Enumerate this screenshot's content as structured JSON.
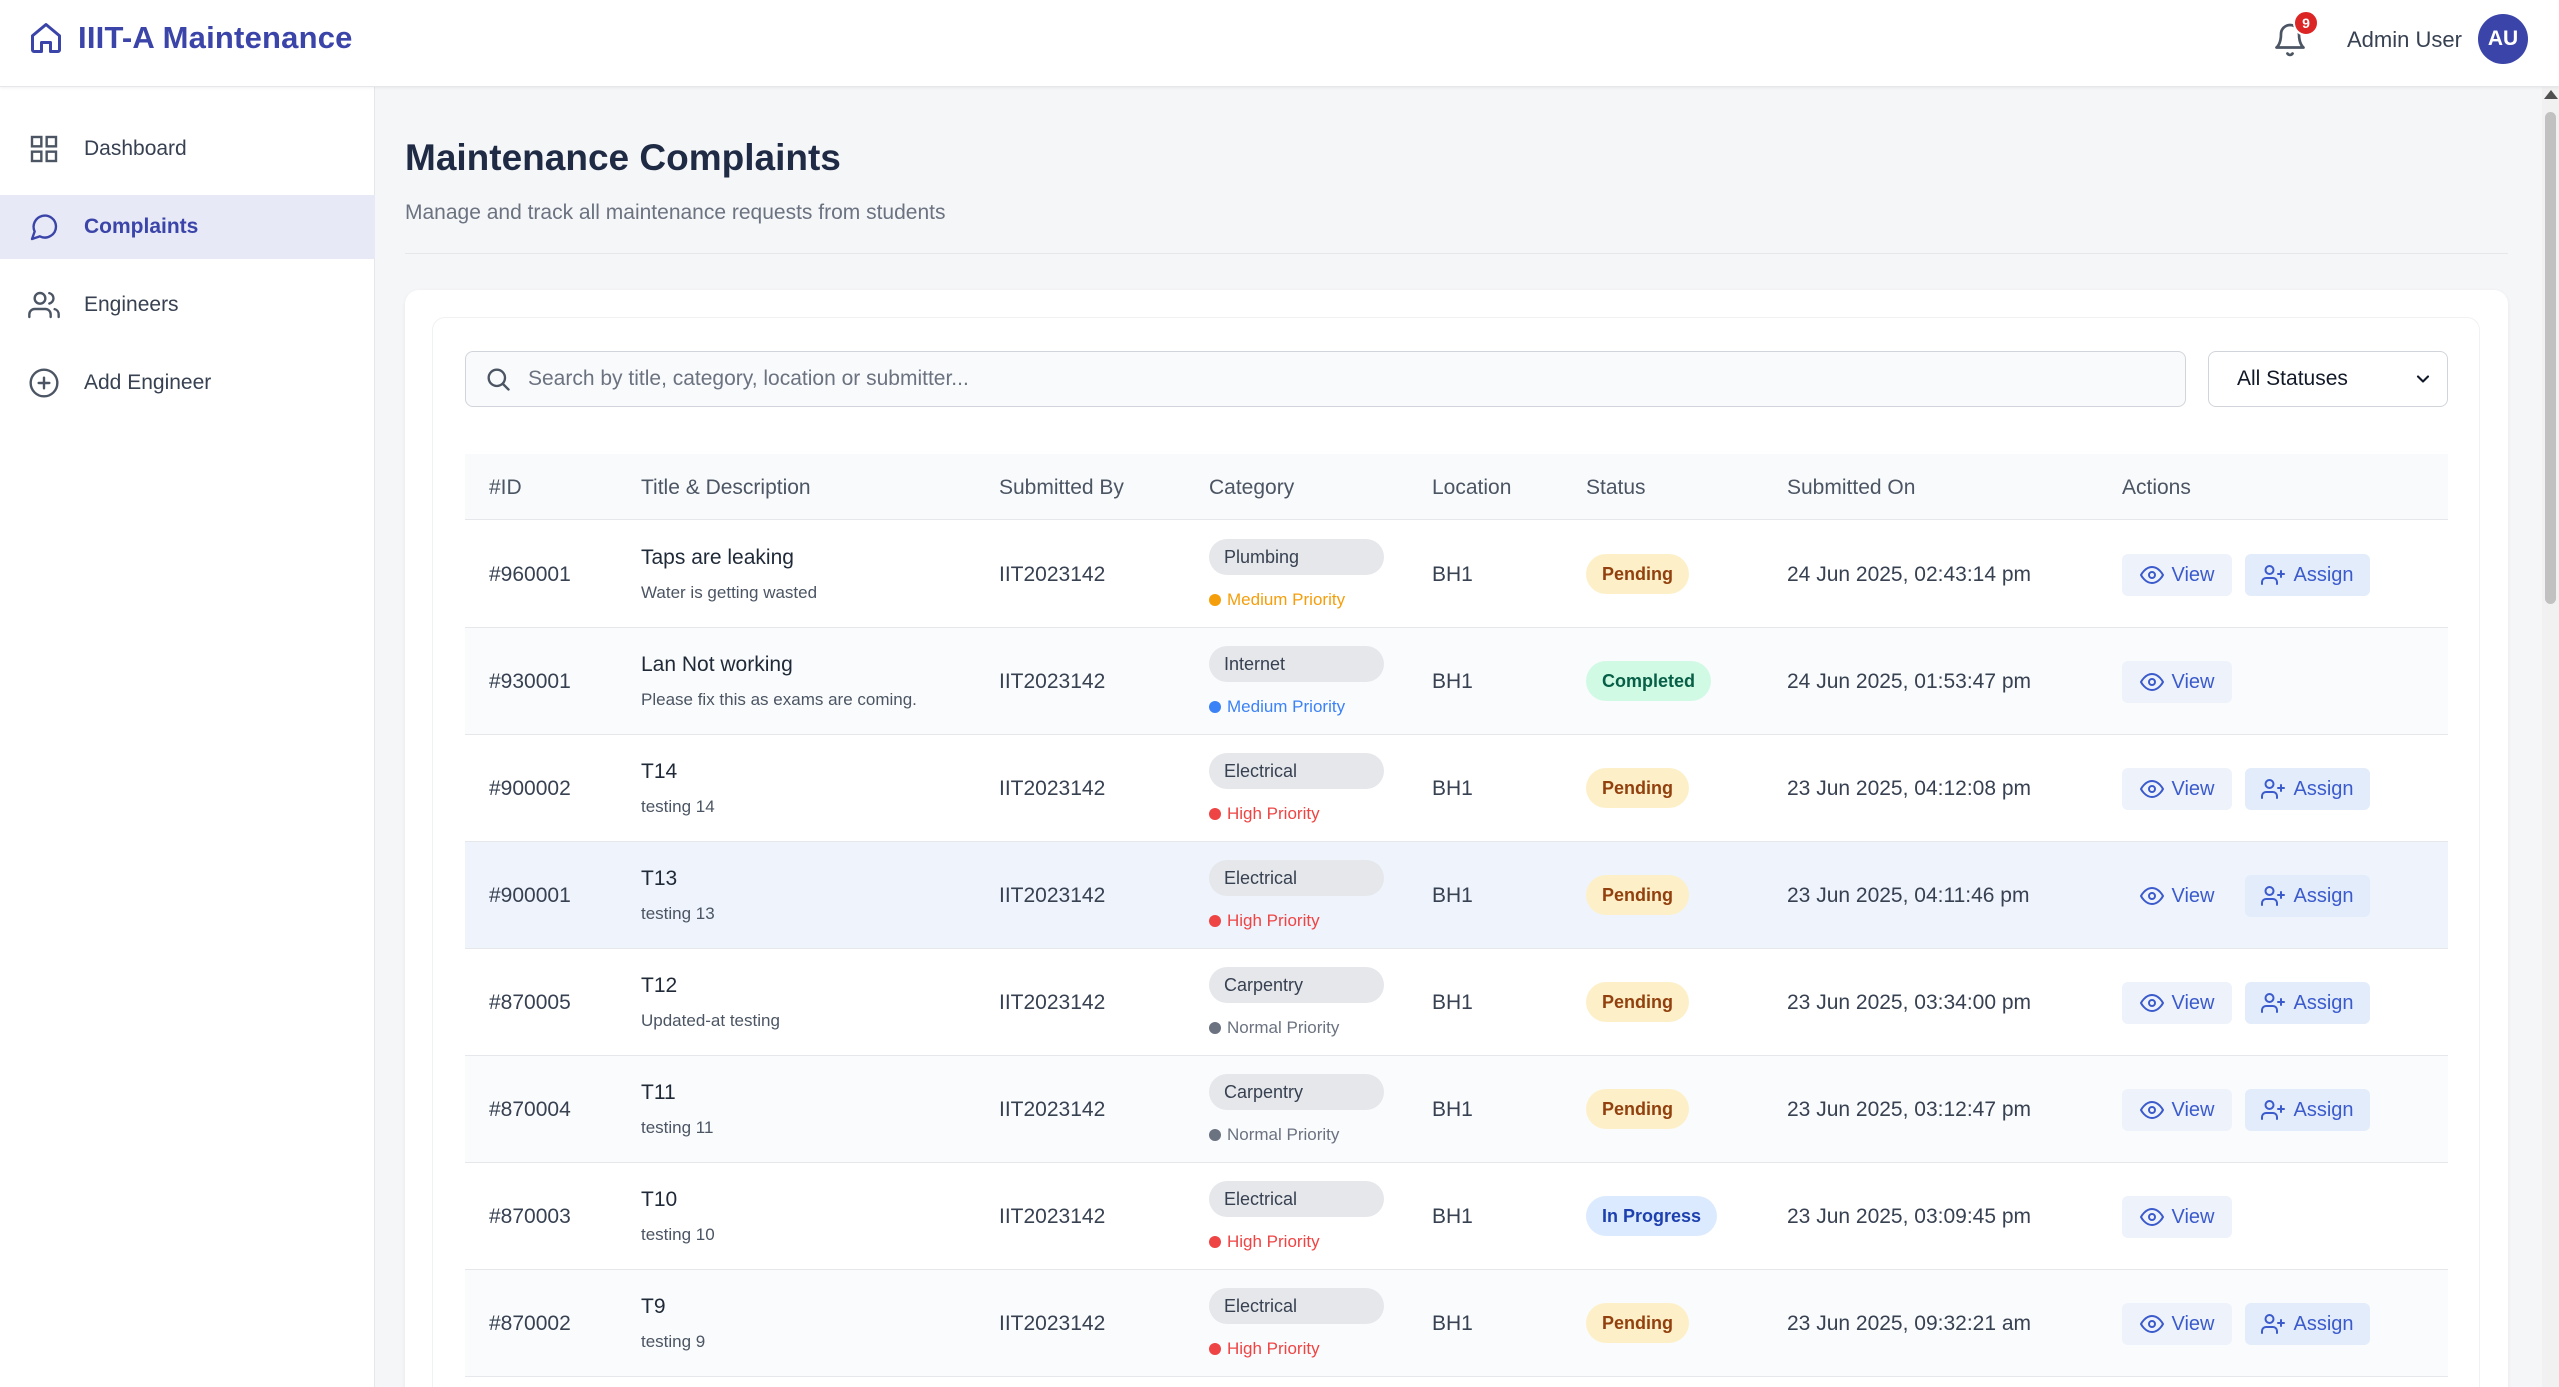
{
  "header": {
    "app_title": "IIIT-A Maintenance",
    "notification_count": "9",
    "user_name": "Admin User",
    "avatar_initials": "AU"
  },
  "sidebar": {
    "items": [
      {
        "label": "Dashboard",
        "icon": "grid-icon"
      },
      {
        "label": "Complaints",
        "icon": "chat-icon",
        "active": true
      },
      {
        "label": "Engineers",
        "icon": "users-icon"
      },
      {
        "label": "Add Engineer",
        "icon": "plus-circle-icon"
      }
    ]
  },
  "page": {
    "title": "Maintenance Complaints",
    "subtitle": "Manage and track all maintenance requests from students"
  },
  "filters": {
    "search_placeholder": "Search by title, category, location or submitter...",
    "status_selected": "All Statuses"
  },
  "table": {
    "headers": [
      "#ID",
      "Title & Description",
      "Submitted By",
      "Category",
      "Location",
      "Status",
      "Submitted On",
      "Actions"
    ],
    "view_label": "View",
    "assign_label": "Assign",
    "rows": [
      {
        "id": "#960001",
        "title": "Taps are leaking",
        "desc": "Water is getting wasted",
        "by": "IIT2023142",
        "category": "Plumbing",
        "priority": "Medium Priority",
        "priority_color": "#f59e0b",
        "location": "BH1",
        "status": "Pending",
        "date": "24 Jun 2025, 02:43:14 pm",
        "assignable": true
      },
      {
        "id": "#930001",
        "title": "Lan Not working",
        "desc": "Please fix this as exams are coming.",
        "by": "IIT2023142",
        "category": "Internet",
        "priority": "Medium Priority",
        "priority_color": "#3b82f6",
        "location": "BH1",
        "status": "Completed",
        "date": "24 Jun 2025, 01:53:47 pm",
        "assignable": false
      },
      {
        "id": "#900002",
        "title": "T14",
        "desc": "testing 14",
        "by": "IIT2023142",
        "category": "Electrical",
        "priority": "High Priority",
        "priority_color": "#ef4444",
        "location": "BH1",
        "status": "Pending",
        "date": "23 Jun 2025, 04:12:08 pm",
        "assignable": true
      },
      {
        "id": "#900001",
        "title": "T13",
        "desc": "testing 13",
        "by": "IIT2023142",
        "category": "Electrical",
        "priority": "High Priority",
        "priority_color": "#ef4444",
        "location": "BH1",
        "status": "Pending",
        "date": "23 Jun 2025, 04:11:46 pm",
        "assignable": true
      },
      {
        "id": "#870005",
        "title": "T12",
        "desc": "Updated-at testing",
        "by": "IIT2023142",
        "category": "Carpentry",
        "priority": "Normal Priority",
        "priority_color": "#6b7280",
        "location": "BH1",
        "status": "Pending",
        "date": "23 Jun 2025, 03:34:00 pm",
        "assignable": true
      },
      {
        "id": "#870004",
        "title": "T11",
        "desc": "testing 11",
        "by": "IIT2023142",
        "category": "Carpentry",
        "priority": "Normal Priority",
        "priority_color": "#6b7280",
        "location": "BH1",
        "status": "Pending",
        "date": "23 Jun 2025, 03:12:47 pm",
        "assignable": true
      },
      {
        "id": "#870003",
        "title": "T10",
        "desc": "testing 10",
        "by": "IIT2023142",
        "category": "Electrical",
        "priority": "High Priority",
        "priority_color": "#ef4444",
        "location": "BH1",
        "status": "In Progress",
        "date": "23 Jun 2025, 03:09:45 pm",
        "assignable": false
      },
      {
        "id": "#870002",
        "title": "T9",
        "desc": "testing 9",
        "by": "IIT2023142",
        "category": "Electrical",
        "priority": "High Priority",
        "priority_color": "#ef4444",
        "location": "BH1",
        "status": "Pending",
        "date": "23 Jun 2025, 09:32:21 am",
        "assignable": true
      }
    ]
  },
  "status_colors": {
    "Pending": {
      "bg": "#fdf0c8",
      "fg": "#92400e"
    },
    "Completed": {
      "bg": "#d1fae5",
      "fg": "#065f46"
    },
    "In Progress": {
      "bg": "#dbeafe",
      "fg": "#1e40af"
    }
  },
  "colors": {
    "brand": "#3b44a8",
    "notification_badge": "#dc2626",
    "action_blue": "#3b5bcc"
  }
}
